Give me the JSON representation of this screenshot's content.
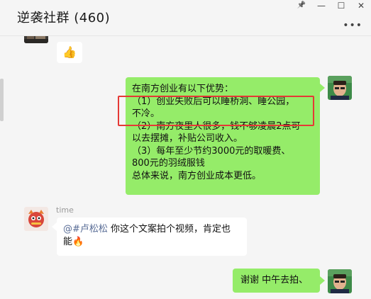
{
  "window": {
    "title": "逆袭社群 (460)",
    "controls": {
      "pin": "📌",
      "minimize": "—",
      "maximize": "☐",
      "close": "✕"
    },
    "more": "•••"
  },
  "messages": [
    {
      "id": "m1",
      "side": "left",
      "content": "👍"
    },
    {
      "id": "m2",
      "side": "right",
      "lines": [
        "在南方创业有以下优势：",
        "（1）创业失败后可以睡桥洞、睡公园，",
        "不冷。",
        "（2）南方夜里人很多，钱不够凌晨2点可",
        "以去摆摊，补贴公司收入。",
        "（3）每年至少节约3000元的取暖费、",
        "800元的羽绒服钱",
        "总体来说，南方创业成本更低。"
      ]
    },
    {
      "id": "m3",
      "side": "left",
      "sender": "time",
      "mention": "@#卢松松",
      "line1_rest": " 你这个文案拍个视频，肯定也",
      "line2": "能🔥"
    },
    {
      "id": "m4",
      "side": "right",
      "content": "谢谢  中午去拍、"
    }
  ]
}
